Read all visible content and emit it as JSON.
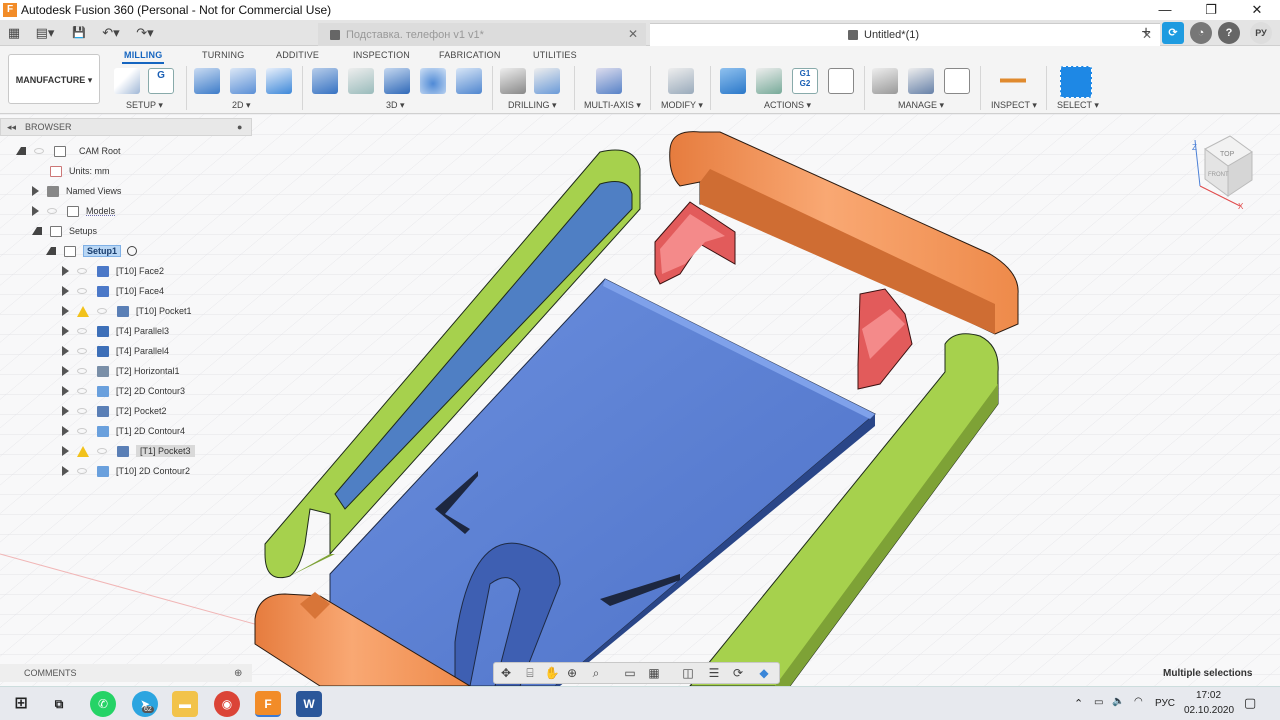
{
  "window": {
    "title": "Autodesk Fusion 360 (Personal - Not for Commercial Use)",
    "minimize": "—",
    "maximize": "❐",
    "close": "✕"
  },
  "quick_access": {
    "grid": "▦",
    "file": "▤▾",
    "save": "💾",
    "undo": "↶▾",
    "redo": "↷▾"
  },
  "tabs": [
    {
      "label": "Подставка. телефон v1 v1*",
      "close": "✕"
    },
    {
      "label": "Untitled*(1)",
      "close": "✕"
    }
  ],
  "top_right": {
    "add": "+",
    "user_initials": "РУ"
  },
  "ribbon": {
    "workspace": "MANUFACTURE ▾",
    "tabs": [
      "MILLING",
      "TURNING",
      "ADDITIVE",
      "INSPECTION",
      "FABRICATION",
      "UTILITIES"
    ],
    "groups": [
      "SETUP ▾",
      "2D ▾",
      "3D ▾",
      "DRILLING ▾",
      "MULTI-AXIS ▾",
      "MODIFY ▾",
      "ACTIONS ▾",
      "MANAGE ▾",
      "INSPECT ▾",
      "SELECT ▾"
    ],
    "icon_labels": {
      "g_code": "G",
      "g1g2": "G1\nG2"
    }
  },
  "browser": {
    "header": "BROWSER",
    "root": "CAM Root",
    "units": "Units: mm",
    "named_views": "Named Views",
    "models": "Models",
    "setups": "Setups",
    "setup1": "Setup1",
    "operations": [
      {
        "label": "[T10] Face2",
        "warning": false,
        "icon": "face"
      },
      {
        "label": "[T10] Face4",
        "warning": false,
        "icon": "face"
      },
      {
        "label": "[T10] Pocket1",
        "warning": true,
        "icon": "pocket"
      },
      {
        "label": "[T4] Parallel3",
        "warning": false,
        "icon": "parallel"
      },
      {
        "label": "[T4] Parallel4",
        "warning": false,
        "icon": "parallel"
      },
      {
        "label": "[T2] Horizontal1",
        "warning": false,
        "icon": "horizontal"
      },
      {
        "label": "[T2] 2D Contour3",
        "warning": false,
        "icon": "contour"
      },
      {
        "label": "[T2] Pocket2",
        "warning": false,
        "icon": "pocket"
      },
      {
        "label": "[T1] 2D Contour4",
        "warning": false,
        "icon": "contour"
      },
      {
        "label": "[T1] Pocket3",
        "warning": true,
        "icon": "pocket"
      },
      {
        "label": "[T10] 2D Contour2",
        "warning": false,
        "icon": "contour"
      }
    ]
  },
  "comments": "COMMENTS",
  "viewcube": {
    "top": "TOP",
    "front": "FRONT",
    "axis_z": "Z",
    "axis_x": "X"
  },
  "status": "Multiple selections",
  "tray": {
    "lang": "РУС",
    "time": "17:02",
    "date": "02.10.2020",
    "badge": "62"
  },
  "colors": {
    "accent": "#1565c0",
    "plate": "#5b7fd1",
    "green": "#a7d24f",
    "orange": "#ef8d4f",
    "red": "#e25b5b"
  }
}
